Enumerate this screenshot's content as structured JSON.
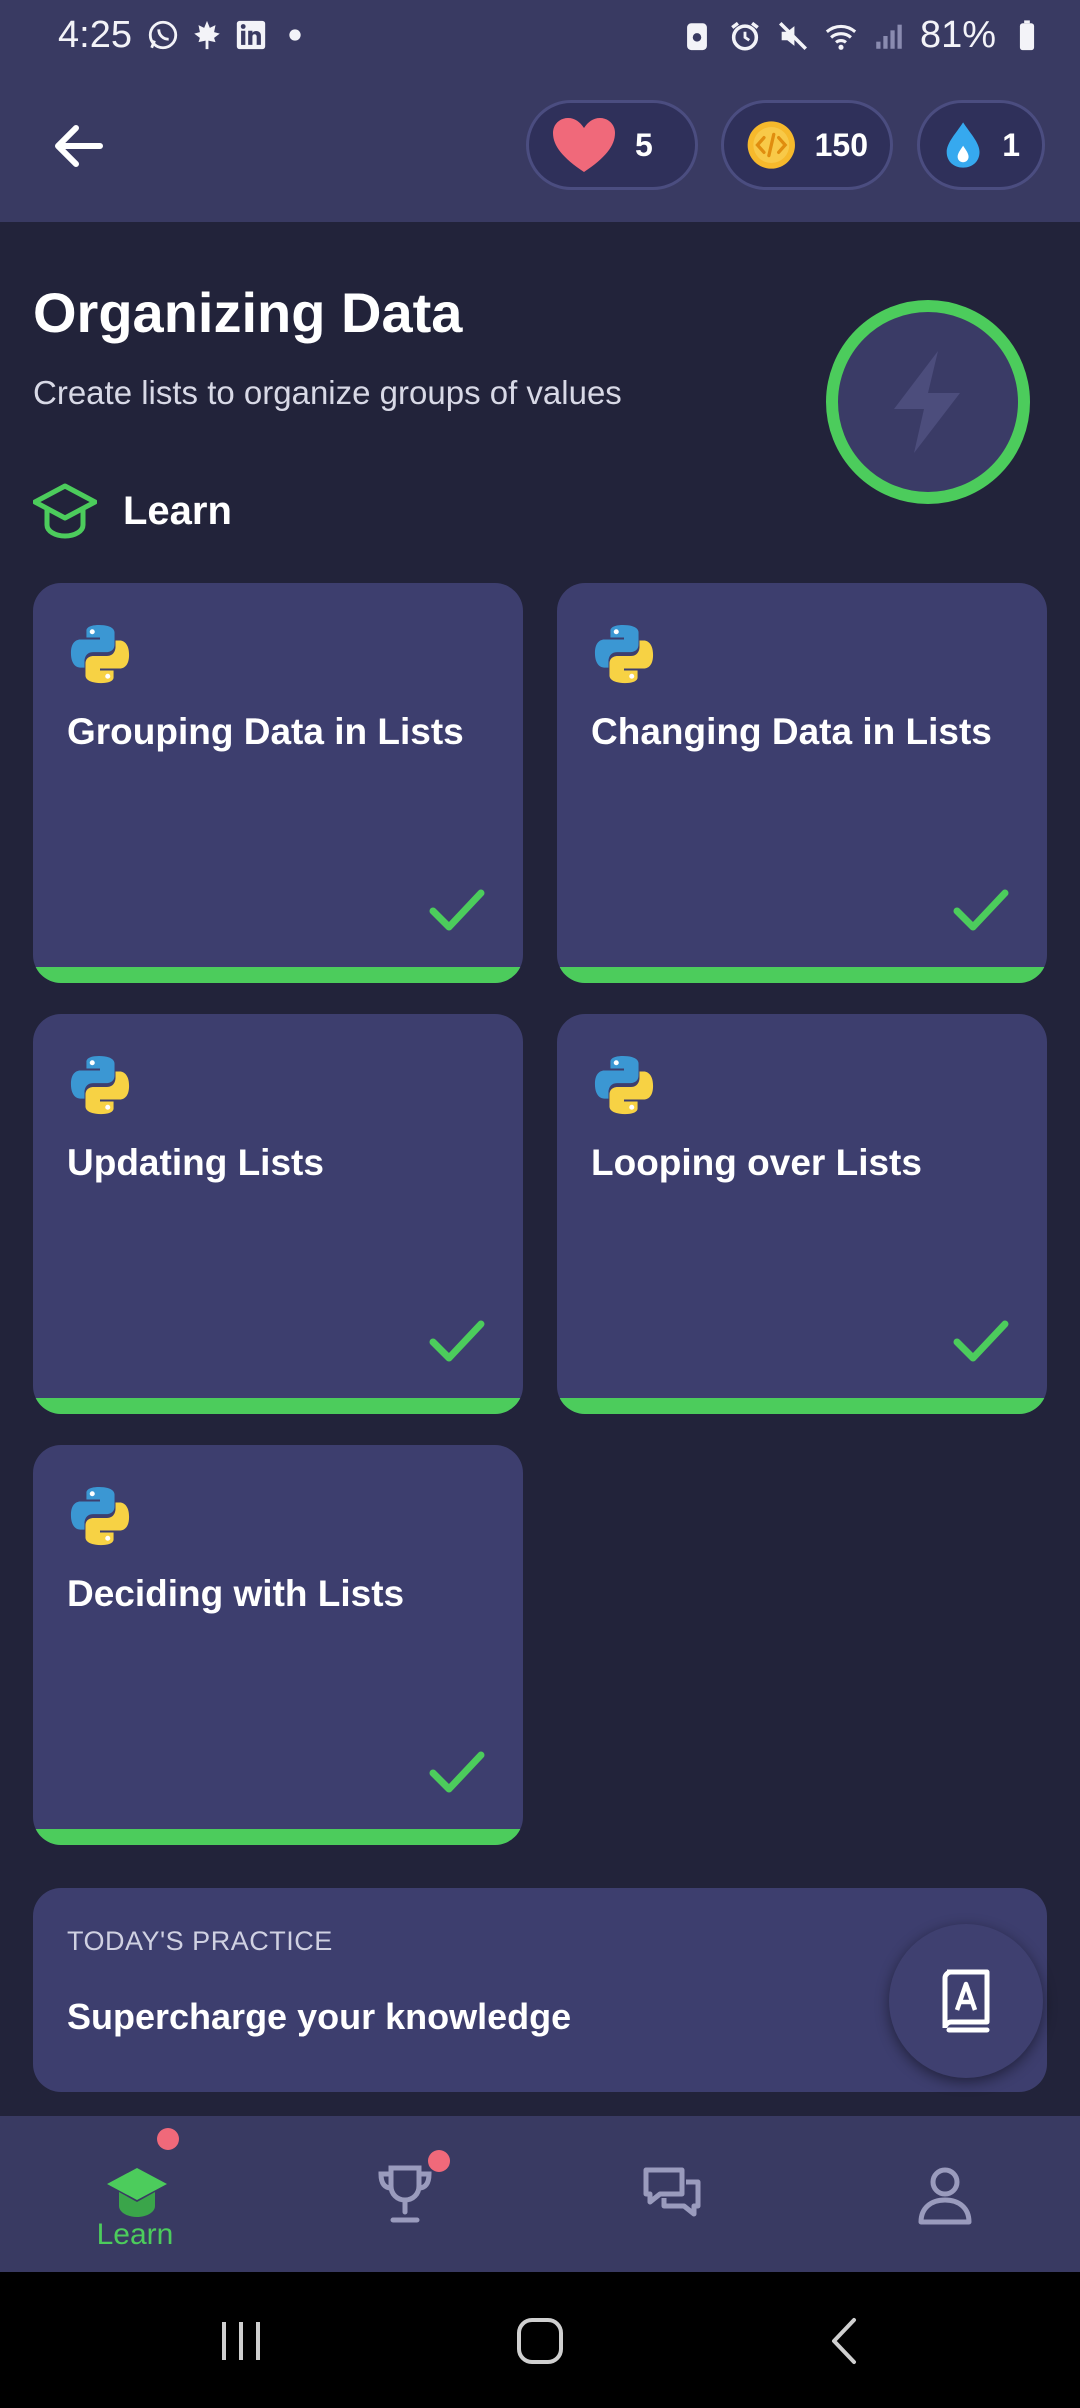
{
  "status_bar": {
    "time": "4:25",
    "battery": "81%"
  },
  "header": {
    "hearts": "5",
    "coins": "150",
    "streak": "1"
  },
  "course": {
    "title": "Organizing Data",
    "subtitle": "Create lists to organize groups of values",
    "section_label": "Learn"
  },
  "lessons": [
    {
      "title": "Grouping Data in Lists",
      "progress": 1.0,
      "completed": true
    },
    {
      "title": "Changing Data in Lists",
      "progress": 1.0,
      "completed": true
    },
    {
      "title": "Updating Lists",
      "progress": 1.0,
      "completed": true
    },
    {
      "title": "Looping over Lists",
      "progress": 1.0,
      "completed": true
    },
    {
      "title": "Deciding with Lists",
      "progress": 1.0,
      "completed": true
    }
  ],
  "practice": {
    "kicker": "TODAY'S PRACTICE",
    "heading": "Supercharge your knowledge"
  },
  "bottom_nav": {
    "learn_label": "Learn"
  },
  "colors": {
    "accent_green": "#4ccc5c",
    "card": "#3d3e6e",
    "background": "#22233a",
    "header": "#393a62",
    "notification_dot": "#f0697a"
  }
}
